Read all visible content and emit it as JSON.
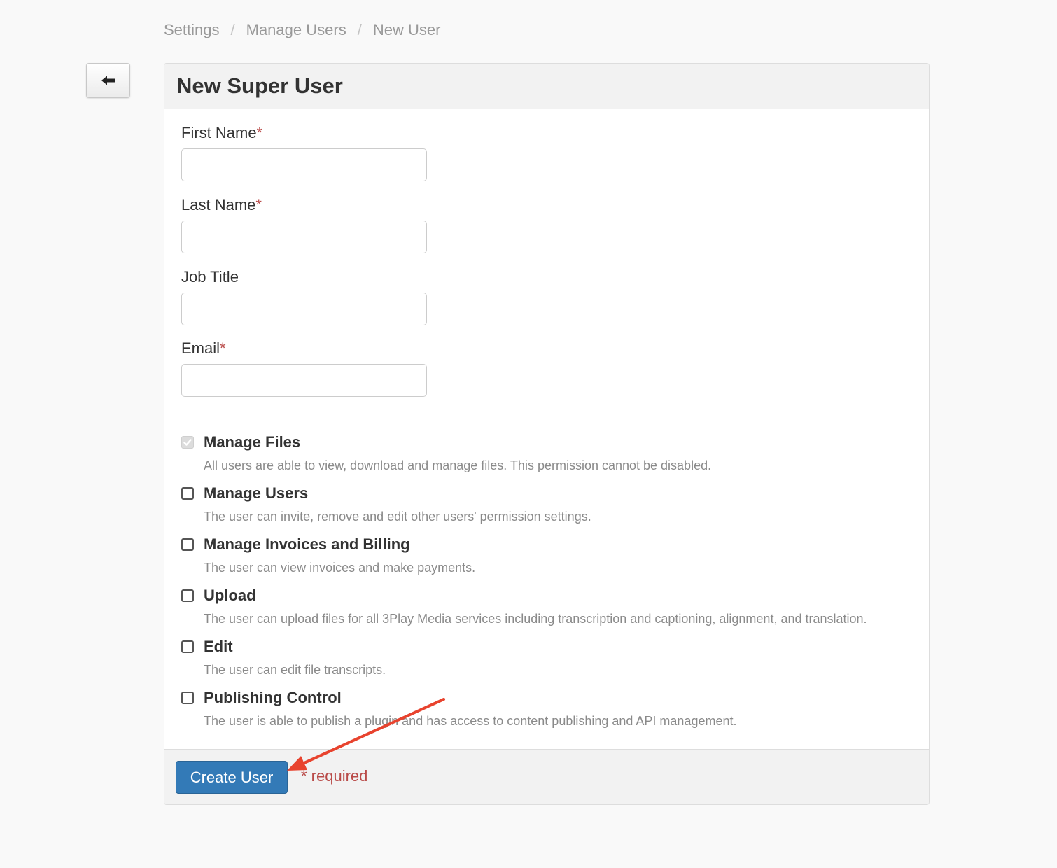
{
  "breadcrumb": {
    "items": [
      "Settings",
      "Manage Users",
      "New User"
    ],
    "separator": "/"
  },
  "back_button": {
    "icon": "arrow-left-icon"
  },
  "panel": {
    "title": "New Super User"
  },
  "form": {
    "fields": [
      {
        "label": "First Name",
        "required_mark": "*",
        "value": "",
        "placeholder": ""
      },
      {
        "label": "Last Name",
        "required_mark": "*",
        "value": "",
        "placeholder": ""
      },
      {
        "label": "Job Title",
        "required_mark": "",
        "value": "",
        "placeholder": ""
      },
      {
        "label": "Email",
        "required_mark": "*",
        "value": "",
        "placeholder": ""
      }
    ]
  },
  "permissions": [
    {
      "title": "Manage Files",
      "description": "All users are able to view, download and manage files. This permission cannot be disabled.",
      "checked": true,
      "disabled": true
    },
    {
      "title": "Manage Users",
      "description": "The user can invite, remove and edit other users' permission settings.",
      "checked": false,
      "disabled": false
    },
    {
      "title": "Manage Invoices and Billing",
      "description": "The user can view invoices and make payments.",
      "checked": false,
      "disabled": false
    },
    {
      "title": "Upload",
      "description": "The user can upload files for all 3Play Media services including transcription and captioning, alignment, and translation.",
      "checked": false,
      "disabled": false
    },
    {
      "title": "Edit",
      "description": "The user can edit file transcripts.",
      "checked": false,
      "disabled": false
    },
    {
      "title": "Publishing Control",
      "description": "The user is able to publish a plugin and has access to content publishing and API management.",
      "checked": false,
      "disabled": false
    }
  ],
  "footer": {
    "submit_label": "Create User",
    "required_note": "* required"
  },
  "colors": {
    "primary": "#337ab7",
    "required": "#b94a48",
    "annotation_arrow": "#e8432e"
  }
}
